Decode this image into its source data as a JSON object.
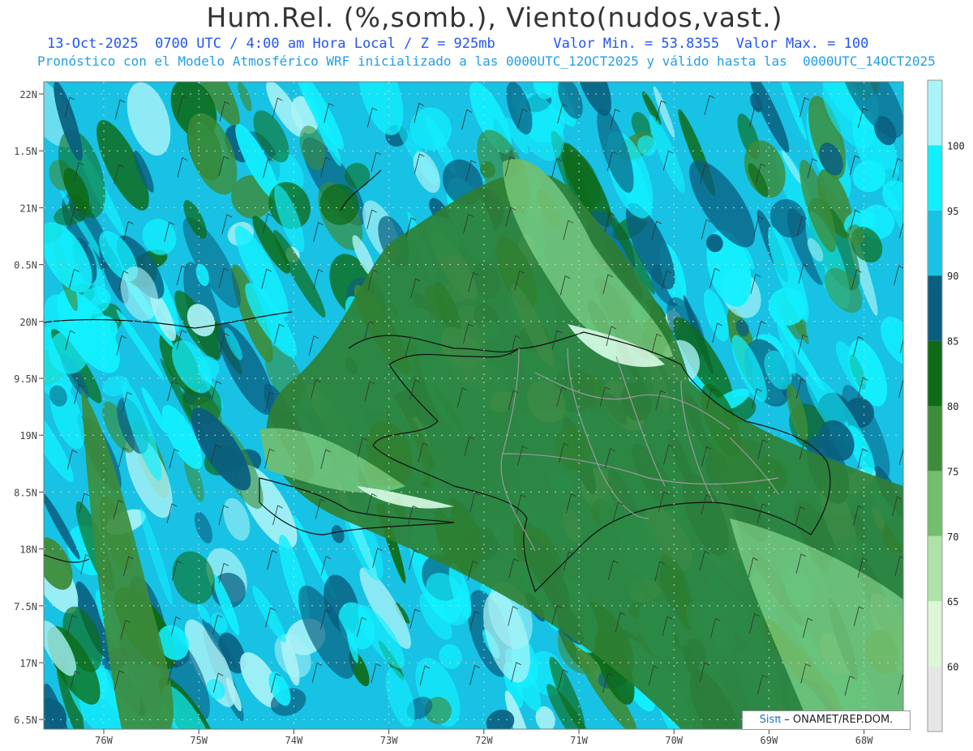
{
  "header": {
    "title": "Hum.Rel. (%,somb.), Viento(nudos,vast.)",
    "date": "13-Oct-2025",
    "time_info": "0700 UTC / 4:00 am Hora Local / Z = 925mb",
    "min_value": "Valor Min. = 53.8355",
    "max_value": "Valor Max. = 100",
    "forecast_info": "Pronóstico con el Modelo Atmosférico WRF inicializado a las 0000UTC_12OCT2025 y válido hasta las  0000UTC_14OCT2025"
  },
  "axes": {
    "lat_labels": [
      "22N",
      "1.5N",
      "21N",
      "0.5N",
      "20N",
      "9.5N",
      "19N",
      "8.5N",
      "18N",
      "7.5N",
      "17N",
      "6.5N"
    ],
    "lon_labels": [
      "76W",
      "75W",
      "74W",
      "73W",
      "72W",
      "71W",
      "70W",
      "69W",
      "68W"
    ]
  },
  "colorbar": {
    "labels": [
      "100",
      "95",
      "90",
      "85",
      "80",
      "75",
      "70",
      "65",
      "60"
    ],
    "colors": [
      "#aaf3f7",
      "#12f0ff",
      "#17c2e4",
      "#0a5f7f",
      "#0e6a16",
      "#3d8c3b",
      "#72bf6e",
      "#aee2a8",
      "#dcf6d6",
      "#e6e6e6"
    ]
  },
  "credit": {
    "brand": "Sisπ",
    "text": "– ONAMET/REP.DOM."
  }
}
